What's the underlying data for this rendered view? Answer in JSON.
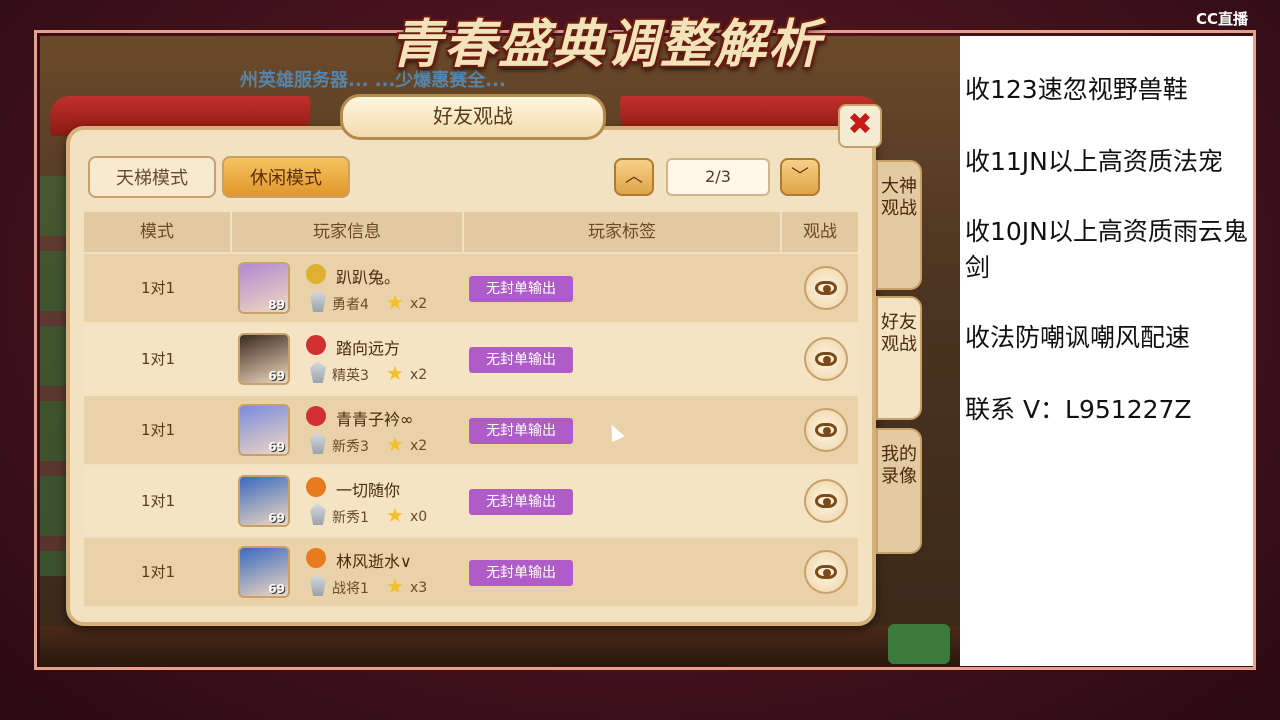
{
  "stream": {
    "banner_title": "青春盛典调整解析",
    "logo": "CC直播"
  },
  "game_bg_text": "州英雄服务器... ...少爆惠赛全...",
  "dialog": {
    "title": "好友观战",
    "close_label": "✖",
    "mode_tabs": [
      {
        "label": "天梯模式",
        "active": false
      },
      {
        "label": "休闲模式",
        "active": true
      }
    ],
    "pagination": {
      "current": "2/3",
      "up_icon": "chevron-up-icon",
      "down_icon": "chevron-down-icon"
    },
    "columns": [
      "模式",
      "玩家信息",
      "玩家标签",
      "观战"
    ],
    "rows": [
      {
        "mode": "1对1",
        "name": "趴趴兔。",
        "level": "89",
        "rank": "勇者4",
        "stars": "x2",
        "tag": "无封单输出",
        "school_color": "#e0b030",
        "avatar_color": "#b08ad0"
      },
      {
        "mode": "1对1",
        "name": "踏向远方",
        "level": "69",
        "rank": "精英3",
        "stars": "x2",
        "tag": "无封单输出",
        "school_color": "#d03030",
        "avatar_color": "#3a2a20"
      },
      {
        "mode": "1对1",
        "name": "青青子衿∞",
        "level": "69",
        "rank": "新秀3",
        "stars": "x2",
        "tag": "无封单输出",
        "school_color": "#d03030",
        "avatar_color": "#7a8ae0"
      },
      {
        "mode": "1对1",
        "name": "一切随你",
        "level": "69",
        "rank": "新秀1",
        "stars": "x0",
        "tag": "无封单输出",
        "school_color": "#e87a20",
        "avatar_color": "#3a6ac0"
      },
      {
        "mode": "1对1",
        "name": "林风逝水∨",
        "level": "69",
        "rank": "战将1",
        "stars": "x3",
        "tag": "无封单输出",
        "school_color": "#e87a20",
        "avatar_color": "#3a6ac0"
      }
    ],
    "side_tabs": [
      {
        "label": "大神观战",
        "active": false
      },
      {
        "label": "好友观战",
        "active": true
      },
      {
        "label": "我的录像",
        "active": false
      }
    ]
  },
  "right_panel": {
    "lines": [
      "收123速忽视野兽鞋",
      "收11JN以上高资质法宠",
      "收10JN以上高资质雨云鬼剑",
      "收法防嘲讽嘲风配速",
      "联系 V：L951227Z"
    ]
  }
}
